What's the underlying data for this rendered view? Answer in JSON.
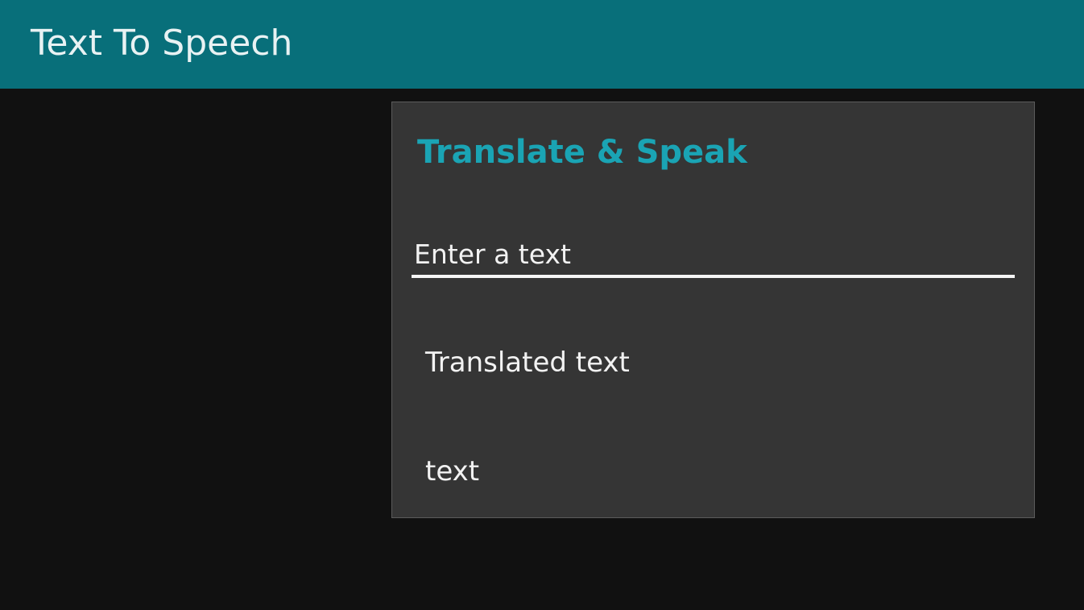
{
  "header": {
    "title": "Text To Speech",
    "background_color": "#086f7a"
  },
  "card": {
    "title": "Translate & Speak",
    "title_color": "#1aa4b4",
    "input": {
      "value": "",
      "placeholder": "Enter a text"
    },
    "translated_label": "Translated text",
    "output_text": "text"
  }
}
